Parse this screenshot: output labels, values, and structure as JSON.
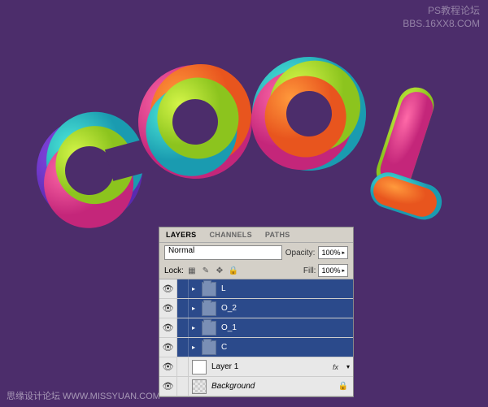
{
  "watermark": {
    "line1": "PS教程论坛",
    "line2": "BBS.16XX8.COM",
    "bottom": "思缘设计论坛  WWW.MISSYUAN.COM"
  },
  "artwork": {
    "text": "COOL"
  },
  "panel": {
    "tabs": {
      "layers": "LAYERS",
      "channels": "CHANNELS",
      "paths": "PATHS"
    },
    "blend_mode": "Normal",
    "opacity_label": "Opacity:",
    "opacity_value": "100%",
    "lock_label": "Lock:",
    "fill_label": "Fill:",
    "fill_value": "100%",
    "layers": [
      {
        "name": "L",
        "type": "folder",
        "selected": true
      },
      {
        "name": "O_2",
        "type": "folder",
        "selected": true
      },
      {
        "name": "O_1",
        "type": "folder",
        "selected": true
      },
      {
        "name": "C",
        "type": "folder",
        "selected": true
      },
      {
        "name": "Layer 1",
        "type": "layer",
        "selected": false,
        "fx": "fx"
      },
      {
        "name": "Background",
        "type": "background",
        "selected": false
      }
    ]
  }
}
